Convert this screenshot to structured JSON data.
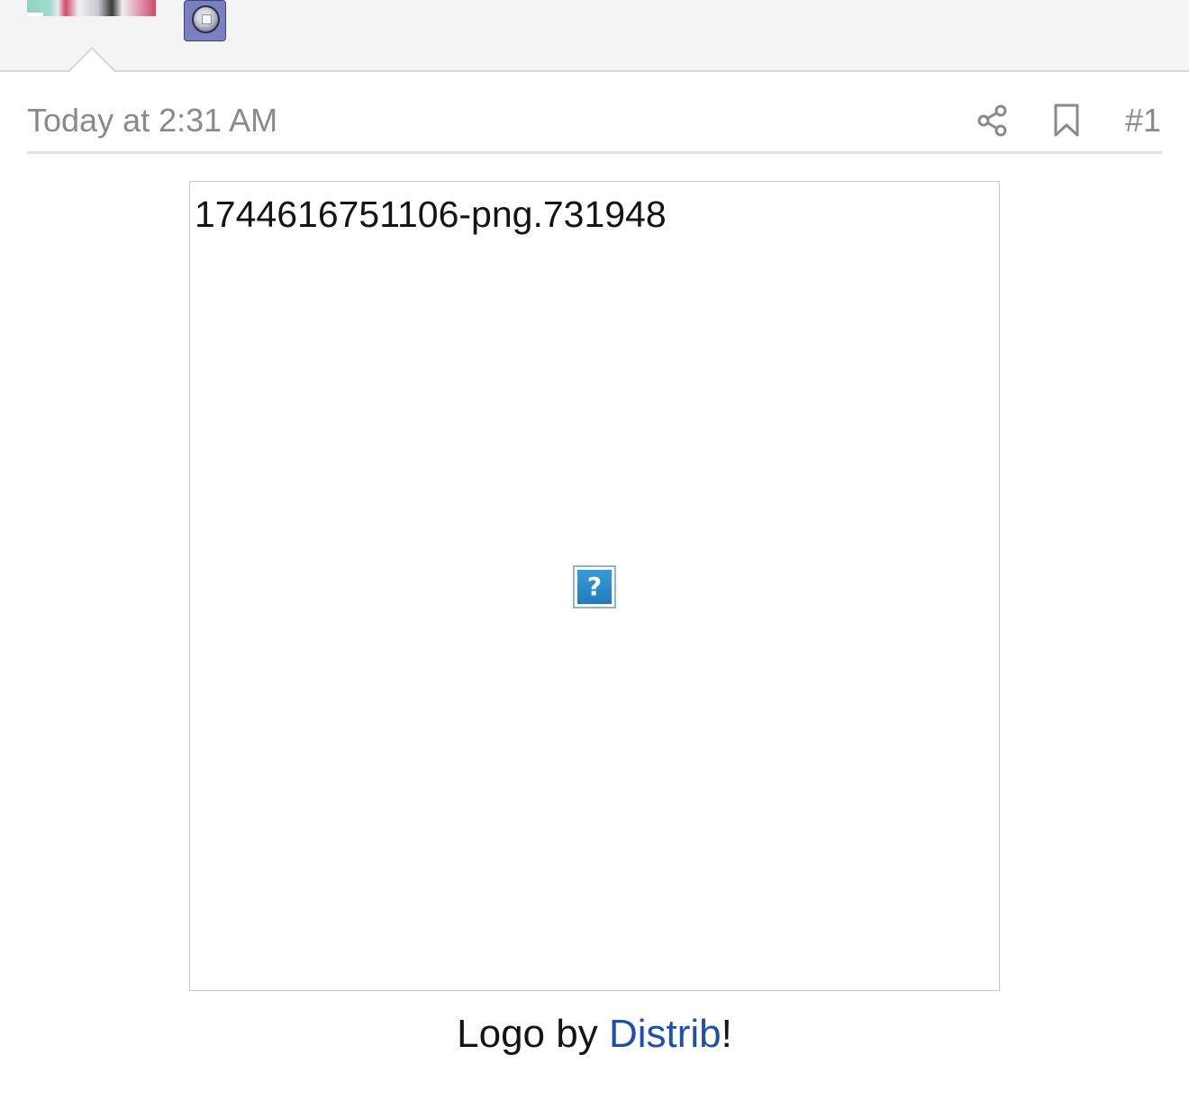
{
  "post": {
    "date": "Today at 2:31 AM",
    "number": "#1"
  },
  "icons": {
    "share": "share-icon",
    "bookmark": "bookmark-icon",
    "broken_image": "question-mark-icon"
  },
  "attachment": {
    "alt_text": "1744616751106-png.731948",
    "placeholder_glyph": "?"
  },
  "credit": {
    "prefix": "Logo by ",
    "link_text": "Distrib",
    "suffix": "!"
  },
  "colors": {
    "link": "#1c4fae",
    "muted": "#8a8a8a",
    "header_bg": "#f4f4f4"
  }
}
